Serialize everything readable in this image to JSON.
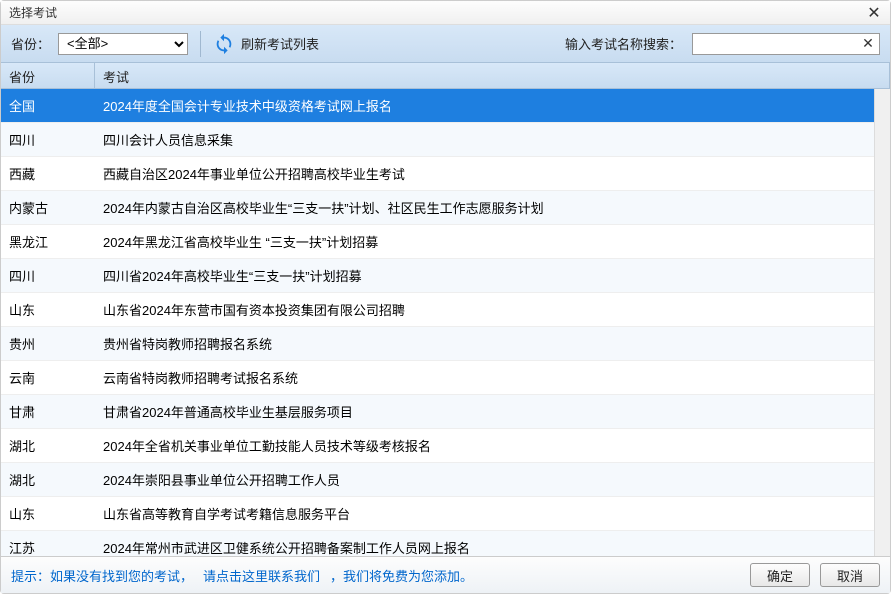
{
  "window": {
    "title": "选择考试"
  },
  "toolbar": {
    "province_label": "省份：",
    "province_value": "<全部>",
    "refresh_label": "刷新考试列表",
    "search_label": "输入考试名称搜索：",
    "search_value": ""
  },
  "table": {
    "headers": {
      "province": "省份",
      "exam": "考试"
    },
    "rows": [
      {
        "province": "全国",
        "exam": "2024年度全国会计专业技术中级资格考试网上报名",
        "selected": true
      },
      {
        "province": "四川",
        "exam": "四川会计人员信息采集",
        "selected": false
      },
      {
        "province": "西藏",
        "exam": "西藏自治区2024年事业单位公开招聘高校毕业生考试",
        "selected": false
      },
      {
        "province": "内蒙古",
        "exam": "2024年内蒙古自治区高校毕业生“三支一扶”计划、社区民生工作志愿服务计划",
        "selected": false
      },
      {
        "province": "黑龙江",
        "exam": "2024年黑龙江省高校毕业生 “三支一扶”计划招募",
        "selected": false
      },
      {
        "province": "四川",
        "exam": "四川省2024年高校毕业生“三支一扶”计划招募",
        "selected": false
      },
      {
        "province": "山东",
        "exam": "山东省2024年东营市国有资本投资集团有限公司招聘",
        "selected": false
      },
      {
        "province": "贵州",
        "exam": "贵州省特岗教师招聘报名系统",
        "selected": false
      },
      {
        "province": "云南",
        "exam": "云南省特岗教师招聘考试报名系统",
        "selected": false
      },
      {
        "province": "甘肃",
        "exam": "甘肃省2024年普通高校毕业生基层服务项目",
        "selected": false
      },
      {
        "province": "湖北",
        "exam": "2024年全省机关事业单位工勤技能人员技术等级考核报名",
        "selected": false
      },
      {
        "province": "湖北",
        "exam": "2024年崇阳县事业单位公开招聘工作人员",
        "selected": false
      },
      {
        "province": "山东",
        "exam": "山东省高等教育自学考试考籍信息服务平台",
        "selected": false
      },
      {
        "province": "江苏",
        "exam": "2024年常州市武进区卫健系统公开招聘备案制工作人员网上报名",
        "selected": false
      }
    ]
  },
  "footer": {
    "hint_prefix": "提示：如果没有找到您的考试，",
    "hint_link": "请点击这里联系我们",
    "hint_suffix": "，我们将免费为您添加。",
    "ok_label": "确定",
    "cancel_label": "取消"
  }
}
